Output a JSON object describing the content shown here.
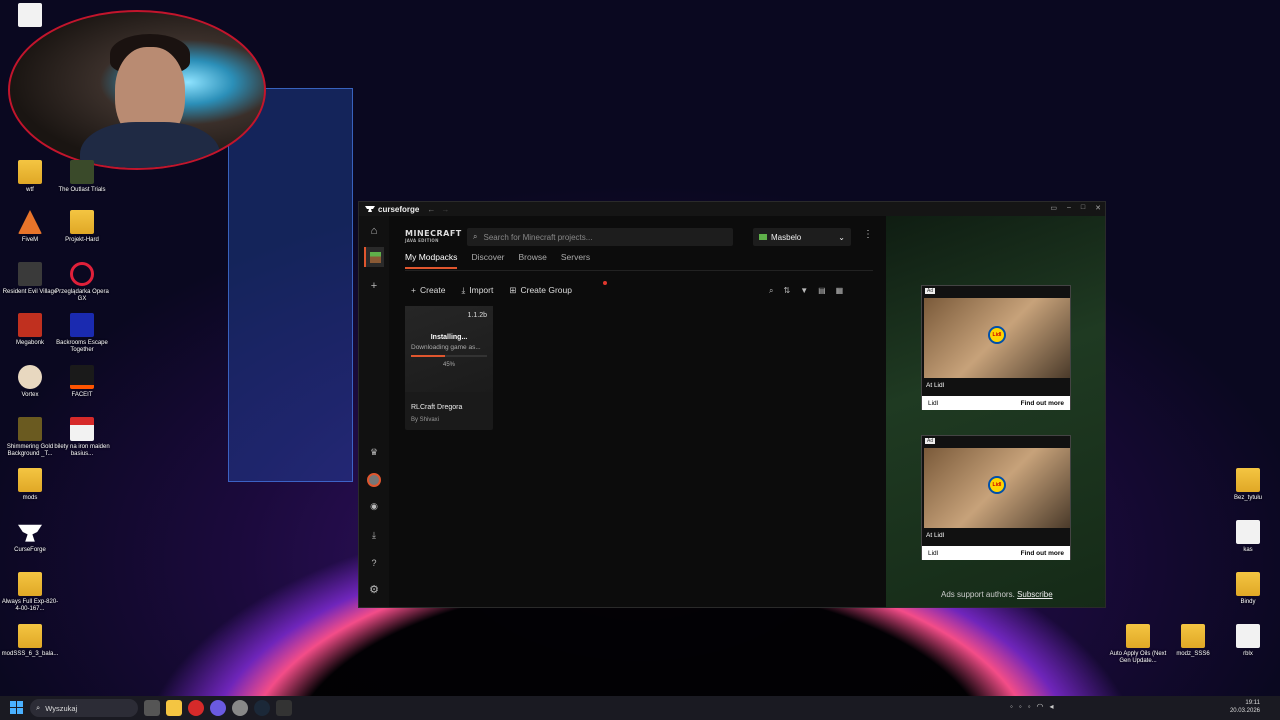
{
  "desktop": {
    "left_icons": [
      {
        "label": "wtf",
        "kind": "folder"
      },
      {
        "label": "The Outlast Trials",
        "kind": "app"
      },
      {
        "label": "FiveM",
        "kind": "app"
      },
      {
        "label": "Projekt-Hard",
        "kind": "folder"
      },
      {
        "label": "Resident Evil Village",
        "kind": "app"
      },
      {
        "label": "Przeglądarka Opera GX",
        "kind": "app"
      },
      {
        "label": "Megabonk",
        "kind": "app"
      },
      {
        "label": "Backrooms Escape Together",
        "kind": "app"
      },
      {
        "label": "Vortex",
        "kind": "app"
      },
      {
        "label": "FACEIT",
        "kind": "app"
      },
      {
        "label": "Shimmering Gold Background _T...",
        "kind": "file"
      },
      {
        "label": "bilety na iron maiden basius...",
        "kind": "pdf"
      },
      {
        "label": "mods",
        "kind": "folder"
      },
      {
        "label": "CurseForge",
        "kind": "app"
      },
      {
        "label": "Always Full Exp-820-4-00-167...",
        "kind": "folder"
      },
      {
        "label": "modSSS_6_3_bala...",
        "kind": "folder"
      }
    ],
    "right_icons": [
      {
        "label": "Bez_tytułu",
        "kind": "folder"
      },
      {
        "label": "kas",
        "kind": "file"
      },
      {
        "label": "Bindy",
        "kind": "folder"
      },
      {
        "label": "Auto Apply Oils (Next Gen Update...",
        "kind": "folder"
      },
      {
        "label": "modz_SSS6",
        "kind": "folder"
      },
      {
        "label": "rblx",
        "kind": "file"
      }
    ]
  },
  "app": {
    "title": "curseforge",
    "back_icon": "←",
    "forward_icon": "→",
    "game_logo": "MINECRAFT",
    "game_logo_sub": "JAVA EDITION",
    "search_placeholder": "Search for Minecraft projects...",
    "profile_name": "Masbelo",
    "tabs": [
      "My Modpacks",
      "Discover",
      "Browse",
      "Servers"
    ],
    "toolbar": {
      "create": "Create",
      "import": "Import",
      "create_group": "Create Group"
    },
    "modpack": {
      "version": "1.1.2b",
      "status": "Installing...",
      "detail": "Downloading game as...",
      "progress": 45,
      "progress_label": "45%",
      "name": "RLCraft Dregora",
      "author": "By Shivaxi"
    },
    "ads": [
      {
        "tag": "Ad",
        "caption": "At Lidl",
        "cta": "Find out more",
        "advertiser": "Lidl"
      },
      {
        "tag": "Ad",
        "caption": "At Lidl",
        "cta": "Find out more",
        "advertiser": "Lidl"
      }
    ],
    "ad_support": "Ads support authors.",
    "subscribe": "Subscribe"
  },
  "taskbar": {
    "search_label": "Wyszukaj",
    "time": "19:11",
    "date": "20.03.2026"
  },
  "colors": {
    "accent": "#e0562e"
  }
}
